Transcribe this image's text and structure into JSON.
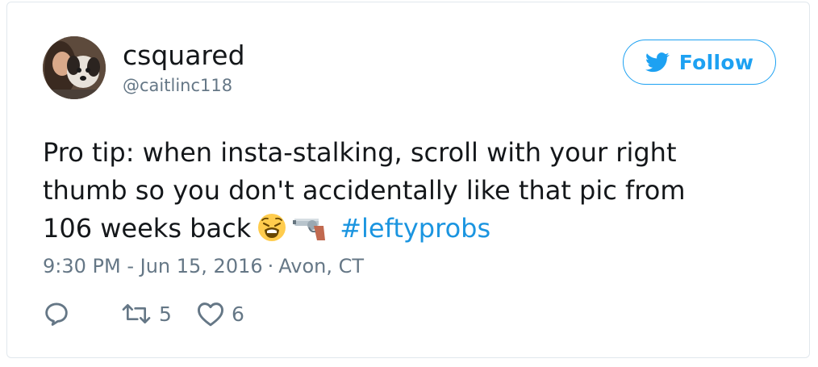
{
  "tweet": {
    "user": {
      "display_name": "csquared",
      "handle": "@caitlinc118"
    },
    "follow_label": "Follow",
    "text": {
      "line1": "Pro tip: when insta-stalking, scroll with your right",
      "line2": "thumb so you don't accidentally like that pic from",
      "line3": "106 weeks back",
      "emojis": [
        "weary-face",
        "pistol"
      ],
      "hashtag": "#leftyprobs"
    },
    "meta": {
      "timestamp": "9:30 PM - Jun 15, 2016",
      "separator": "·",
      "location": "Avon, CT"
    },
    "actions": {
      "reply_icon": "reply-icon",
      "retweet_icon": "retweet-icon",
      "retweet_count": "5",
      "like_icon": "heart-icon",
      "like_count": "6"
    },
    "colors": {
      "accent": "#1da1f2",
      "hashtag": "#1b95e0",
      "text": "#14171a",
      "muted": "#657786",
      "border": "#e1e8ed"
    }
  }
}
